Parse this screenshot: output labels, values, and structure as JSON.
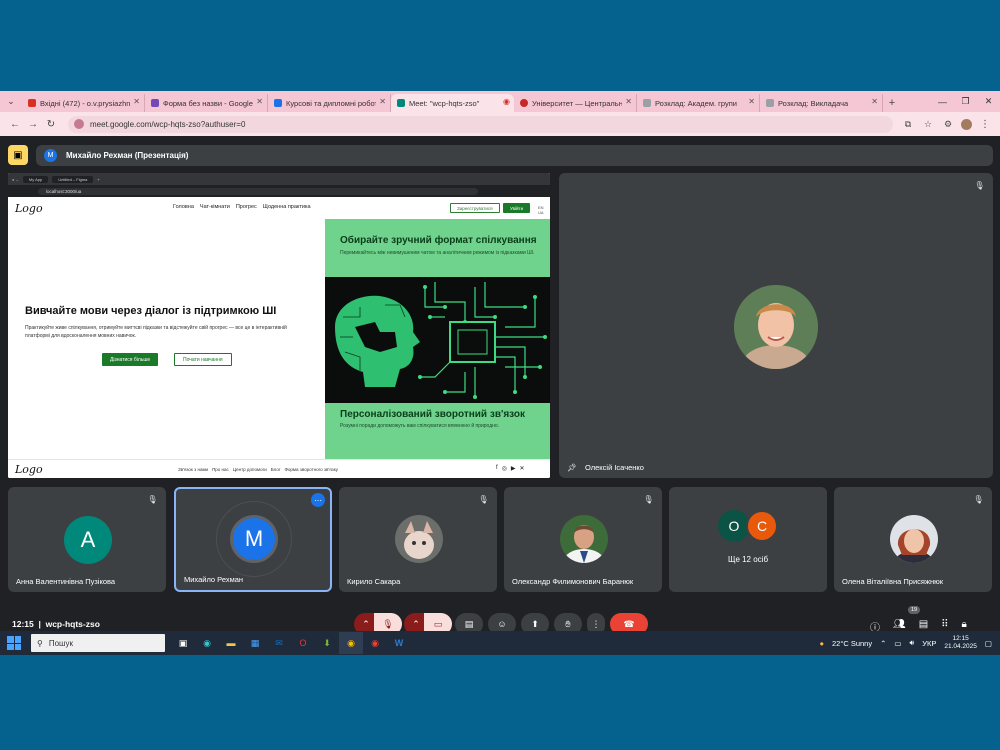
{
  "browser": {
    "tabs": [
      {
        "title": "Вхідні (472) - o.v.prysiazhniuk@",
        "color": "#d93025"
      },
      {
        "title": "Форма без назви - Google Фор",
        "color": "#7248b9"
      },
      {
        "title": "Курсові та дипломні роботи \"",
        "color": "#1a73e8"
      },
      {
        "title": "Meet: \"wcp-hqts-zso\"",
        "color": "#00897b",
        "active": true
      },
      {
        "title": "Університет — Центральноук",
        "color": "#c62828"
      },
      {
        "title": "Розклад: Академ. групи",
        "color": "#9aa0a6"
      },
      {
        "title": "Розклад: Викладача",
        "color": "#9aa0a6"
      }
    ],
    "url": "meet.google.com/wcp-hqts-zso?authuser=0"
  },
  "meet": {
    "presenter_label": "Михайло Рехман (Презентація)",
    "presenter_initial": "M",
    "pinned_name": "Олексій Ісаченко",
    "tiles": [
      {
        "name": "Анна Валентинівна Пузікова",
        "initial": "A",
        "color": "#00897b"
      },
      {
        "name": "Михайло Рехман",
        "initial": "M",
        "color": "#1a73e8"
      },
      {
        "name": "Кирило Сакара"
      },
      {
        "name": "Олександр Филимонович Баранюк"
      },
      {
        "name": "Ще 12 осіб",
        "initials": [
          "O",
          "C"
        ]
      },
      {
        "name": "Олена Віталіївна Присяжнюк"
      }
    ],
    "time": "12:15",
    "meeting_code": "wcp-hqts-zso",
    "people_count": "19"
  },
  "shared_screen": {
    "browser_tabs": [
      "My App",
      "Untitled – Figma"
    ],
    "url": "localhost:3000/ua",
    "logo": "Logo",
    "nav": [
      "Головна",
      "Чат-кімнати",
      "Прогрес",
      "Щоденна практика"
    ],
    "register": "Зареєструватися",
    "login": "Увійти",
    "lang": "EN UA",
    "hero_title": "Вивчайте мови через діалог із підтримкою ШІ",
    "hero_text": "Практикуйте живе спілкування, отримуйте миттєві підказки та відстежуйте свій прогрес — все це в інтерактивній платформі для вдосконалення мовних навичок.",
    "cta_primary": "Дізнатися більше",
    "cta_secondary": "Почати навчання",
    "feature1_title": "Обирайте зручний формат спілкування",
    "feature1_text": "Перемикайтесь між невимушеним чатом та аналітичним режимом із підказками ШІ.",
    "feature2_title": "Персоналізований зворотний зв'язок",
    "feature2_text": "Розумні поради допоможуть вам спілкуватися впевнено й природно.",
    "footer_nav": [
      "Зв'язок з нами",
      "Про нас",
      "Центр допомоги",
      "Блог",
      "Форма зворотного зв'язку"
    ]
  },
  "taskbar": {
    "search": "Пошук",
    "weather": "22°C  Sunny",
    "lang": "УКР",
    "time": "12:15",
    "date": "21.04.2025"
  }
}
